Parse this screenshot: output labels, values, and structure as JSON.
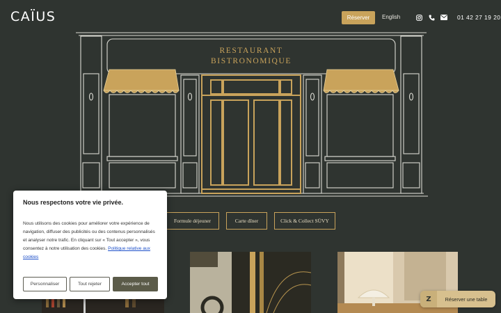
{
  "header": {
    "logo": "CAÏUS",
    "reserve_label": "Réserver",
    "language_label": "English",
    "phone": "01 42 27 19 20",
    "icons": [
      "instagram-icon",
      "phone-icon",
      "mail-icon"
    ]
  },
  "hero": {
    "sign_line1": "RESTAURANT",
    "sign_line2": "BISTRONOMIQUE"
  },
  "menu_buttons": {
    "lunch": "Formule déjeuner",
    "dinner": "Carte dîner",
    "click_collect": "Click & Collect SÜVY"
  },
  "cookie_banner": {
    "title": "Nous respectons votre vie privée.",
    "body": "Nous utilisons des cookies pour améliorer votre expérience de navigation, diffuser des publicités ou des contenus personnalisés et analyser notre trafic. En cliquant sur « Tout accepter », vous consentez à notre utilisation des cookies.",
    "policy_link": "Politique relative aux cookies",
    "customize_label": "Personnaliser",
    "reject_label": "Tout rejeter",
    "accept_label": "Accepter tout"
  },
  "booking_widget": {
    "icon_letter": "Z",
    "label": "Réserver une table"
  },
  "colors": {
    "background": "#2f3430",
    "accent": "#c9a35b",
    "accept_button": "#5b5b49",
    "widget": "#d7c08e"
  }
}
